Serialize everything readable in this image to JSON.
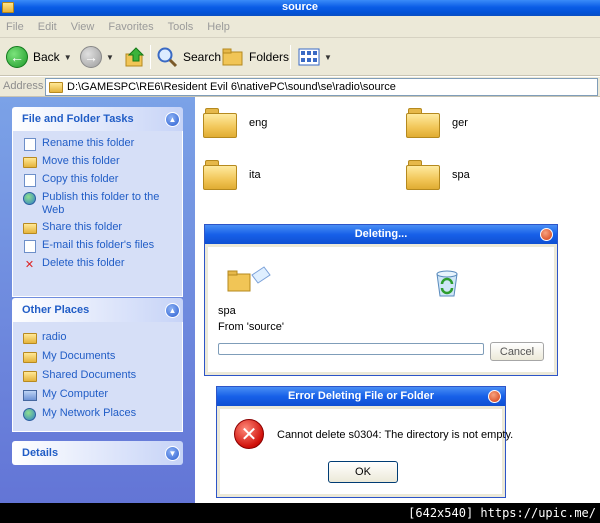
{
  "window": {
    "title": "source"
  },
  "menu": [
    "File",
    "Edit",
    "View",
    "Favorites",
    "Tools",
    "Help"
  ],
  "toolbar": {
    "back_label": "Back",
    "search_label": "Search",
    "folders_label": "Folders"
  },
  "address": {
    "label": "Address",
    "path": "D:\\GAMESPC\\RE6\\Resident Evil 6\\nativePC\\sound\\se\\radio\\source"
  },
  "tasks": {
    "title": "File and Folder Tasks",
    "items": [
      {
        "label": "Rename this folder",
        "icon": "rename-icon"
      },
      {
        "label": "Move this folder",
        "icon": "move-icon"
      },
      {
        "label": "Copy this folder",
        "icon": "copy-icon"
      },
      {
        "label": "Publish this folder to the Web",
        "icon": "publish-icon"
      },
      {
        "label": "Share this folder",
        "icon": "share-icon"
      },
      {
        "label": "E-mail this folder's files",
        "icon": "email-icon"
      },
      {
        "label": "Delete this folder",
        "icon": "delete-icon"
      }
    ]
  },
  "other_places": {
    "title": "Other Places",
    "items": [
      {
        "label": "radio",
        "icon": "folder-icon"
      },
      {
        "label": "My Documents",
        "icon": "folder-icon"
      },
      {
        "label": "Shared Documents",
        "icon": "folder-icon"
      },
      {
        "label": "My Computer",
        "icon": "computer-icon"
      },
      {
        "label": "My Network Places",
        "icon": "network-icon"
      }
    ]
  },
  "details": {
    "title": "Details"
  },
  "folders": [
    "eng",
    "ger",
    "ita",
    "spa"
  ],
  "deleting_dialog": {
    "title": "Deleting...",
    "item": "spa",
    "from": "From 'source'",
    "progress": 0.0,
    "cancel_label": "Cancel"
  },
  "error_dialog": {
    "title": "Error Deleting File or Folder",
    "message": "Cannot delete s0304: The directory is not empty.",
    "ok_label": "OK"
  },
  "watermark": "[642x540] https://upic.me/"
}
